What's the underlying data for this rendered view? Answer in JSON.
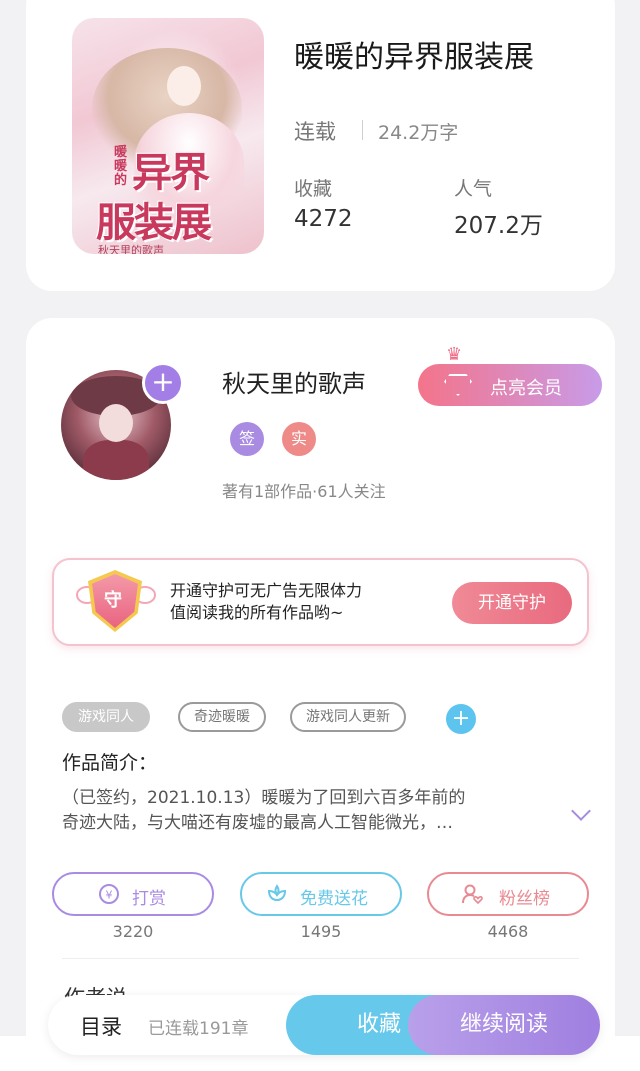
{
  "book": {
    "title": "暖暖的异界服装展",
    "status": "连载",
    "words": "24.2万字",
    "stats": [
      {
        "label": "收藏",
        "value": "4272"
      },
      {
        "label": "人气",
        "value": "207.2万"
      }
    ],
    "cover": {
      "title_small": "暖暖的",
      "title_line1": "异界",
      "title_line2": "服装展",
      "author": "秋天里的歌声"
    }
  },
  "author": {
    "name": "秋天里的歌声",
    "tags": [
      "签",
      "实"
    ],
    "meta": "著有1部作品·61人关注",
    "follow_icon": "+",
    "vip_label": "点亮会员"
  },
  "guard": {
    "shield_char": "守",
    "text_line1": "开通守护可无广告无限体力",
    "text_line2": "值阅读我的所有作品哟~",
    "button": "开通守护"
  },
  "tags": [
    "游戏同人",
    "奇迹暖暖",
    "游戏同人更新"
  ],
  "tag_add": "+",
  "intro": {
    "label": "作品简介：",
    "text_line1": "（已签约，2021.10.13）暖暖为了回到六百多年前的",
    "text_line2": "奇迹大陆，与大喵还有废墟的最高人工智能微光，…"
  },
  "actions": [
    {
      "label": "打赏",
      "count": "3220",
      "icon": "yen-coin-icon",
      "color": "#a98be2"
    },
    {
      "label": "免费送花",
      "count": "1495",
      "icon": "flower-icon",
      "color": "#68c8e8"
    },
    {
      "label": "粉丝榜",
      "count": "4468",
      "icon": "fan-user-icon",
      "color": "#e88a92"
    }
  ],
  "next_section_partial": "作者说",
  "bottom": {
    "toc": "目录",
    "chapters": "已连载191章",
    "favorite": "收藏",
    "continue": "继续阅读"
  },
  "colors": {
    "purple": "#a27ee6",
    "pink": "#f4748a",
    "cyan": "#66c8ea"
  }
}
